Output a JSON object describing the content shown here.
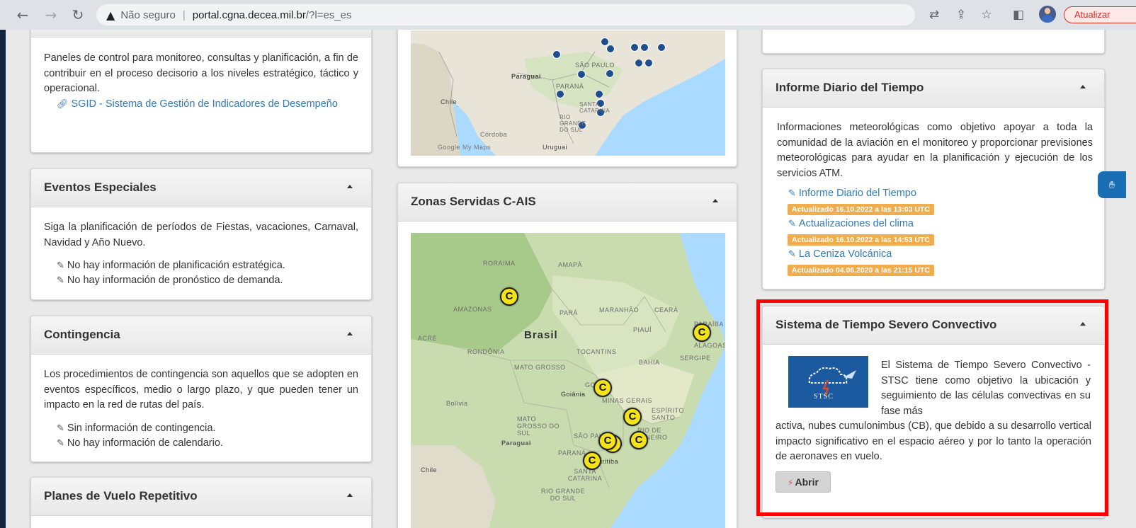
{
  "browser": {
    "not_secure": "Não seguro",
    "host": "portal.cgna.decea.mil.br",
    "path": "/?l=es_es",
    "update_label": "Atualizar"
  },
  "panels": {
    "monitoring": {
      "text": "Paneles de control para monitoreo, consultas y planificación, a fin de contribuir en el proceso decisorio a los niveles estratégico, táctico y operacional.",
      "link": "SGID - Sistema de Gestión de Indicadores de Desempeño"
    },
    "eventos": {
      "title": "Eventos Especiales",
      "text": "Siga la planificación de períodos de Fiestas, vacaciones, Carnaval, Navidad y Año Nuevo.",
      "items": [
        "No hay información de planificación estratégica.",
        "No hay información de pronóstico de demanda."
      ]
    },
    "contingencia": {
      "title": "Contingencia",
      "text": "Los procedimientos de contingencia son aquellos que se adopten en eventos específicos, medio o largo plazo, y que pueden tener un impacto en la red de rutas del país.",
      "items": [
        "Sin información de contingencia.",
        "No hay información de calendario."
      ]
    },
    "planes": {
      "title": "Planes de Vuelo Repetitivo"
    },
    "zonas": {
      "title": "Zonas Servidas C-AIS"
    },
    "informe": {
      "title": "Informe Diario del Tiempo",
      "text": "Informaciones meteorológicas como objetivo apoyar a toda la comunidad de la aviación en el monitoreo y proporcionar previsiones meteorológicas para ayudar en la planificación y ejecución de los servicios ATM.",
      "links": [
        {
          "label": "Informe Diario del Tiempo",
          "badge": "Actualizado 16.10.2022 a las 13:03 UTC"
        },
        {
          "label": "Actualizaciones del clima",
          "badge": "Actualizado 16.10.2022 a las 14:53 UTC"
        },
        {
          "label": "La Ceniza Volcánica",
          "badge": "Actualizado 04.06.2020 a las 21:15 UTC"
        }
      ]
    },
    "stsc": {
      "title": "Sistema de Tiempo Severo Convectivo",
      "text_right": "El Sistema de Tiempo Severo Convectivo - STSC tiene como objetivo la ubicación y seguimiento de las células convectivas en su fase más",
      "text_full": "activa, nubes cumulonimbus (CB), que debido a su desarrollo vertical impacto significativo en el espacio aéreo y por lo tanto la operación de aeronaves en vuelo.",
      "logo_text": "STSC",
      "button": "Abrir"
    }
  },
  "map_top": {
    "labels": [
      "Paraguai",
      "SÃO PAULO",
      "PARANÁ",
      "SANTA CATARINA",
      "RIO GRANDE DO SUL",
      "Chile",
      "Uruguai",
      "Córdoba",
      "Google My Maps"
    ]
  },
  "map_zonas": {
    "labels": [
      "RORAIMA",
      "AMAPÁ",
      "AMAZONAS",
      "PARÁ",
      "MARANHÃO",
      "CEARÁ",
      "ACRE",
      "Brasil",
      "PIAUÍ",
      "RONDÔNIA",
      "TOCANTINS",
      "BAHIA",
      "SERGIPE",
      "ALAGOAS",
      "PARAÍBA",
      "MATO GROSSO",
      "GOIÁS",
      "Goiânia",
      "MINAS GERAIS",
      "ESPÍRITO SANTO",
      "MATO GROSSO DO SUL",
      "SÃO PAULO",
      "RIO DE JANEIRO",
      "Paraguai",
      "PARANÁ",
      "Curitiba",
      "SANTA CATARINA",
      "RIO GRANDE DO SUL",
      "Bolívia",
      "Chile"
    ],
    "marker": "C"
  }
}
